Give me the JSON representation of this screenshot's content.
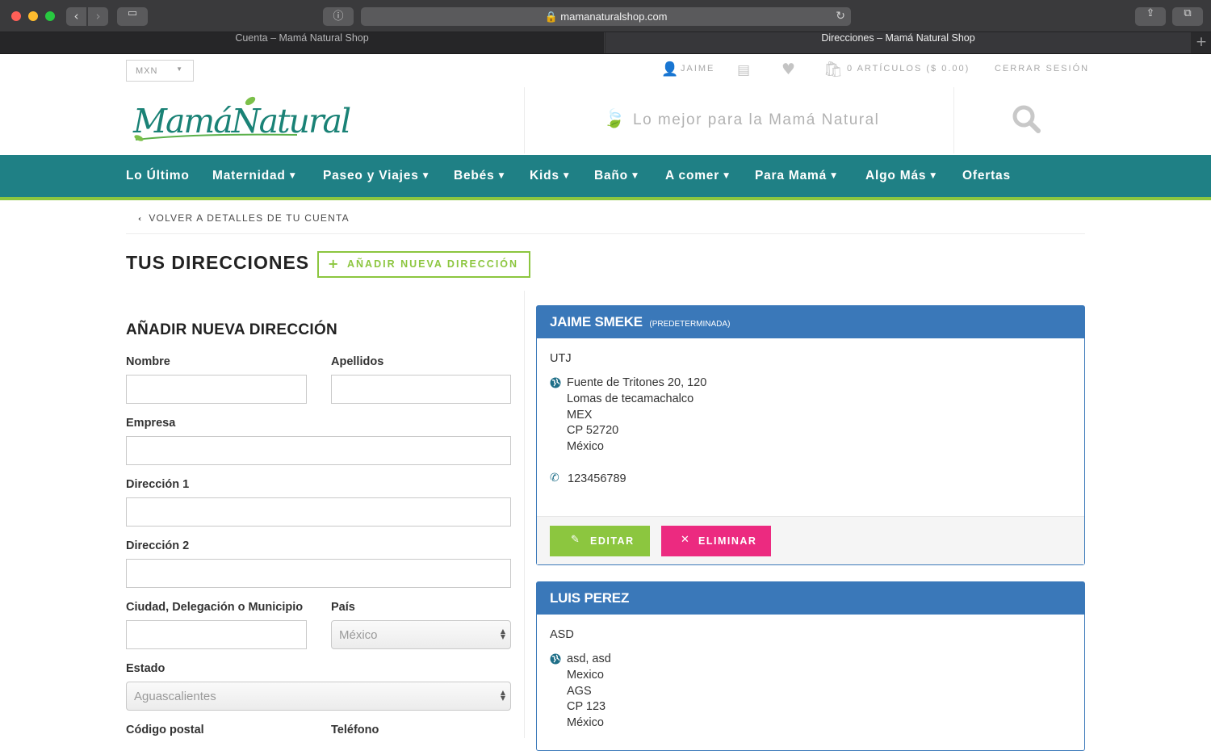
{
  "browser": {
    "url": "mamanaturalshop.com",
    "tabs": [
      "Cuenta – Mamá Natural Shop",
      "Direcciones – Mamá Natural Shop"
    ]
  },
  "header": {
    "currency": "MXN",
    "user": "JAIME",
    "cart": "0 ARTÍCULOS ($ 0.00)",
    "logout": "CERRAR SESIÓN",
    "logo_text": "MamáNatural",
    "tagline": "Lo mejor para la Mamá Natural"
  },
  "nav": {
    "items": [
      "Lo Último",
      "Maternidad",
      "Paseo y Viajes",
      "Bebés",
      "Kids",
      "Baño",
      "A comer",
      "Para Mamá",
      "Algo Más",
      "Ofertas"
    ]
  },
  "page": {
    "back_link": "VOLVER A DETALLES DE TU CUENTA",
    "title": "TUS DIRECCIONES",
    "add_button": "AÑADIR NUEVA DIRECCIÓN"
  },
  "form": {
    "title": "AÑADIR NUEVA DIRECCIÓN",
    "labels": {
      "nombre": "Nombre",
      "apellidos": "Apellidos",
      "empresa": "Empresa",
      "direccion1": "Dirección 1",
      "direccion2": "Dirección 2",
      "ciudad": "Ciudad, Delegación o Municipio",
      "pais": "País",
      "estado": "Estado",
      "cp": "Código postal",
      "telefono": "Teléfono"
    },
    "pais_value": "México",
    "estado_value": "Aguascalientes"
  },
  "addresses": [
    {
      "name": "JAIME SMEKE",
      "default_label": "(PREDETERMINADA)",
      "company": "UTJ",
      "lines": [
        "Fuente de Tritones 20, 120",
        "Lomas de tecamachalco",
        "MEX",
        "CP 52720",
        "México"
      ],
      "phone": "123456789",
      "edit": "EDITAR",
      "delete": "ELIMINAR"
    },
    {
      "name": "LUIS PEREZ",
      "company": "ASD",
      "lines": [
        "asd, asd",
        "Mexico",
        "AGS",
        "CP 123",
        "México"
      ]
    }
  ],
  "colors": {
    "teal": "#1f8085",
    "green": "#8cc63f",
    "blue": "#3a78b9",
    "pink": "#ec2a80"
  }
}
